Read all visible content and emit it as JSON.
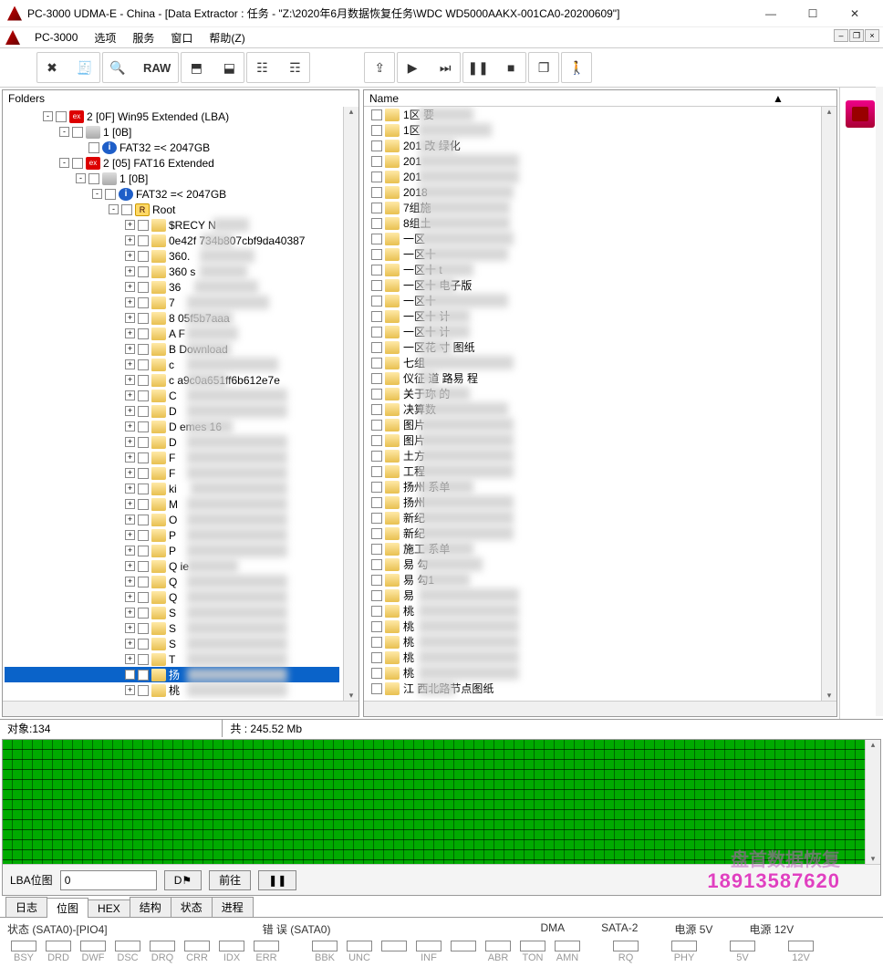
{
  "window": {
    "title": "PC-3000 UDMA-E - China - [Data Extractor : 任务 - \"Z:\\2020年6月数据恢复任务\\WDC WD5000AAKX-001CA0-20200609\"]",
    "min": "—",
    "max": "☐",
    "close": "✕"
  },
  "menu": {
    "items": [
      "PC-3000",
      "选项",
      "服务",
      "窗口",
      "帮助(Z)"
    ]
  },
  "toolbar": {
    "tools_icon": "✖",
    "report_icon": "🧾",
    "search_icon": "🔍",
    "raw_label": "RAW",
    "db_icon1": "⬒",
    "db_icon2": "⬓",
    "flow_icon1": "☷",
    "flow_icon2": "☶",
    "export_icon": "⇪",
    "play_icon": "▶",
    "skip_icon": "⏭",
    "pause_icon": "❚❚",
    "stop_icon": "■",
    "copy_icon": "❐",
    "exit_icon": "🚶"
  },
  "folders": {
    "header": "Folders",
    "tree": [
      {
        "lvl": 0,
        "exp": "-",
        "ico": "ex",
        "txt": "2 [0F] Win95 Extended  (LBA)"
      },
      {
        "lvl": 1,
        "exp": "-",
        "ico": "hdd",
        "txt": "1 [0B]"
      },
      {
        "lvl": 2,
        "exp": "",
        "ico": "info",
        "txt": "FAT32 =< 2047GB"
      },
      {
        "lvl": 1,
        "exp": "-",
        "ico": "ex",
        "txt": "2 [05] FAT16 Extended"
      },
      {
        "lvl": 2,
        "exp": "-",
        "ico": "hdd",
        "txt": "1 [0B]"
      },
      {
        "lvl": 3,
        "exp": "-",
        "ico": "info",
        "txt": "FAT32 =< 2047GB"
      },
      {
        "lvl": 4,
        "exp": "-",
        "ico": "root",
        "txt": "Root"
      },
      {
        "lvl": 5,
        "exp": "+",
        "ico": "fld",
        "txt": "$RECY          N",
        "blur": [
          228,
          40
        ]
      },
      {
        "lvl": 5,
        "exp": "+",
        "ico": "fld",
        "txt": "0e42f        734b807cbf9da40387",
        "blur": [
          216,
          34
        ]
      },
      {
        "lvl": 5,
        "exp": "+",
        "ico": "fld",
        "txt": "360.",
        "blur": [
          214,
          60
        ]
      },
      {
        "lvl": 5,
        "exp": "+",
        "ico": "fld",
        "txt": "360           s",
        "blur": [
          214,
          52
        ]
      },
      {
        "lvl": 5,
        "exp": "+",
        "ico": "fld",
        "txt": "36",
        "blur": [
          208,
          70
        ]
      },
      {
        "lvl": 5,
        "exp": "+",
        "ico": "fld",
        "txt": "7",
        "blur": [
          200,
          90
        ]
      },
      {
        "lvl": 5,
        "exp": "+",
        "ico": "fld",
        "txt": "8            05f5b7aaa",
        "blur": [
          200,
          50
        ]
      },
      {
        "lvl": 5,
        "exp": "+",
        "ico": "fld",
        "txt": "A            F",
        "blur": [
          200,
          56
        ]
      },
      {
        "lvl": 5,
        "exp": "+",
        "ico": "fld",
        "txt": "B           Download",
        "blur": [
          200,
          48
        ]
      },
      {
        "lvl": 5,
        "exp": "+",
        "ico": "fld",
        "txt": "c",
        "blur": [
          200,
          100
        ]
      },
      {
        "lvl": 5,
        "exp": "+",
        "ico": "fld",
        "txt": "c           a9c0a651ff6b612e7e",
        "blur": [
          200,
          44
        ]
      },
      {
        "lvl": 5,
        "exp": "+",
        "ico": "fld",
        "txt": "C",
        "blur": [
          200,
          110
        ]
      },
      {
        "lvl": 5,
        "exp": "+",
        "ico": "fld",
        "txt": "D",
        "blur": [
          200,
          110
        ]
      },
      {
        "lvl": 5,
        "exp": "+",
        "ico": "fld",
        "txt": "D           emes 16",
        "blur": [
          200,
          50
        ]
      },
      {
        "lvl": 5,
        "exp": "+",
        "ico": "fld",
        "txt": "D",
        "blur": [
          200,
          110
        ]
      },
      {
        "lvl": 5,
        "exp": "+",
        "ico": "fld",
        "txt": "F",
        "blur": [
          200,
          110
        ]
      },
      {
        "lvl": 5,
        "exp": "+",
        "ico": "fld",
        "txt": "F",
        "blur": [
          200,
          110
        ]
      },
      {
        "lvl": 5,
        "exp": "+",
        "ico": "fld",
        "txt": "ki",
        "blur": [
          204,
          106
        ]
      },
      {
        "lvl": 5,
        "exp": "+",
        "ico": "fld",
        "txt": "M",
        "blur": [
          200,
          110
        ]
      },
      {
        "lvl": 5,
        "exp": "+",
        "ico": "fld",
        "txt": "O",
        "blur": [
          200,
          110
        ]
      },
      {
        "lvl": 5,
        "exp": "+",
        "ico": "fld",
        "txt": "P",
        "blur": [
          200,
          110
        ]
      },
      {
        "lvl": 5,
        "exp": "+",
        "ico": "fld",
        "txt": "P",
        "blur": [
          200,
          110
        ]
      },
      {
        "lvl": 5,
        "exp": "+",
        "ico": "fld",
        "txt": "Q           ie",
        "blur": [
          200,
          56
        ]
      },
      {
        "lvl": 5,
        "exp": "+",
        "ico": "fld",
        "txt": "Q",
        "blur": [
          200,
          110
        ]
      },
      {
        "lvl": 5,
        "exp": "+",
        "ico": "fld",
        "txt": "Q",
        "blur": [
          200,
          110
        ]
      },
      {
        "lvl": 5,
        "exp": "+",
        "ico": "fld",
        "txt": "S",
        "blur": [
          200,
          110
        ]
      },
      {
        "lvl": 5,
        "exp": "+",
        "ico": "fld",
        "txt": "S",
        "blur": [
          200,
          110
        ]
      },
      {
        "lvl": 5,
        "exp": "+",
        "ico": "fld",
        "txt": "S",
        "blur": [
          200,
          110
        ]
      },
      {
        "lvl": 5,
        "exp": "+",
        "ico": "fld",
        "txt": "T",
        "blur": [
          200,
          110
        ]
      },
      {
        "lvl": 5,
        "exp": "+",
        "ico": "fld",
        "txt": "扬",
        "blur": [
          200,
          110
        ],
        "sel": true
      },
      {
        "lvl": 5,
        "exp": "+",
        "ico": "fld",
        "txt": "桃",
        "blur": [
          200,
          110
        ]
      }
    ]
  },
  "files": {
    "column": "Name",
    "rows": [
      {
        "txt": "1区            要",
        "blur": [
          478,
          60
        ]
      },
      {
        "txt": "1区",
        "blur": [
          470,
          80
        ]
      },
      {
        "txt": "201           改      绿化",
        "blur": [
          470,
          40
        ]
      },
      {
        "txt": "201",
        "blur": [
          470,
          110
        ]
      },
      {
        "txt": "201",
        "blur": [
          470,
          110
        ]
      },
      {
        "txt": "2018",
        "blur": [
          476,
          104
        ]
      },
      {
        "txt": "7组施",
        "blur": [
          480,
          100
        ]
      },
      {
        "txt": "8组土",
        "blur": [
          480,
          100
        ]
      },
      {
        "txt": "一区",
        "blur": [
          476,
          104
        ]
      },
      {
        "txt": "一区十",
        "blur": [
          482,
          98
        ]
      },
      {
        "txt": "一区十       t",
        "blur": [
          482,
          60
        ]
      },
      {
        "txt": "一区十                      电子版",
        "blur": [
          482,
          40
        ]
      },
      {
        "txt": "一区十",
        "blur": [
          482,
          98
        ]
      },
      {
        "txt": "一区十        计",
        "blur": [
          482,
          56
        ]
      },
      {
        "txt": "一区十        计",
        "blur": [
          482,
          56
        ]
      },
      {
        "txt": "一区花       寸      图纸",
        "blur": [
          482,
          36
        ]
      },
      {
        "txt": "七组",
        "blur": [
          476,
          104
        ]
      },
      {
        "txt": "仪征      道      路易      程",
        "blur": [
          476,
          20
        ]
      },
      {
        "txt": "关于珎      的",
        "blur": [
          488,
          56
        ]
      },
      {
        "txt": "决算数",
        "blur": [
          482,
          98
        ]
      },
      {
        "txt": "图片",
        "blur": [
          476,
          104
        ]
      },
      {
        "txt": "图片",
        "blur": [
          476,
          104
        ]
      },
      {
        "txt": "土方",
        "blur": [
          476,
          104
        ]
      },
      {
        "txt": "工程",
        "blur": [
          476,
          104
        ]
      },
      {
        "txt": "扬州      系单",
        "blur": [
          476,
          60
        ]
      },
      {
        "txt": "扬州",
        "blur": [
          476,
          104
        ]
      },
      {
        "txt": "新纪",
        "blur": [
          476,
          104
        ]
      },
      {
        "txt": "新纪",
        "blur": [
          476,
          104
        ]
      },
      {
        "txt": "施工      系单",
        "blur": [
          476,
          60
        ]
      },
      {
        "txt": "易       勾",
        "blur": [
          468,
          70
        ]
      },
      {
        "txt": "易            勾1",
        "blur": [
          468,
          56
        ]
      },
      {
        "txt": "易",
        "blur": [
          468,
          110
        ]
      },
      {
        "txt": "桃",
        "blur": [
          468,
          110
        ]
      },
      {
        "txt": "桃",
        "blur": [
          468,
          110
        ]
      },
      {
        "txt": "桃",
        "blur": [
          468,
          110
        ]
      },
      {
        "txt": "桃",
        "blur": [
          468,
          110
        ]
      },
      {
        "txt": "桃",
        "blur": [
          468,
          110
        ]
      },
      {
        "txt": "江      西北路节点图纸",
        "blur": [
          468,
          40
        ]
      }
    ]
  },
  "status": {
    "objects_label": "对象:",
    "objects_value": "134",
    "total_label": "共 :",
    "total_value": "245.52 Mb"
  },
  "sector": {
    "lba_label": "LBA位图",
    "lba_value": "0",
    "go_btn": "前往",
    "pause": "❚❚",
    "flag": "D⚑"
  },
  "watermark": {
    "phone": "18913587620",
    "text": "盘首数据恢复"
  },
  "tabs": {
    "items": [
      "日志",
      "位图",
      "HEX",
      "结构",
      "状态",
      "进程"
    ],
    "active": 1
  },
  "bottom": {
    "g1_title": "状态 (SATA0)-[PIO4]",
    "g1": [
      "BSY",
      "DRD",
      "DWF",
      "DSC",
      "DRQ",
      "CRR",
      "IDX",
      "ERR"
    ],
    "g2_title": "错 误 (SATA0)",
    "g2": [
      "BBK",
      "UNC",
      "",
      "INF",
      "",
      "ABR",
      "TON",
      "AMN"
    ],
    "g3_title": "DMA",
    "g3": [
      "RQ"
    ],
    "g4_title": "SATA-2",
    "g4": [
      "PHY"
    ],
    "g5_title": "电源 5V",
    "g5": [
      "5V"
    ],
    "g6_title": "电源 12V",
    "g6": [
      "12V"
    ]
  }
}
